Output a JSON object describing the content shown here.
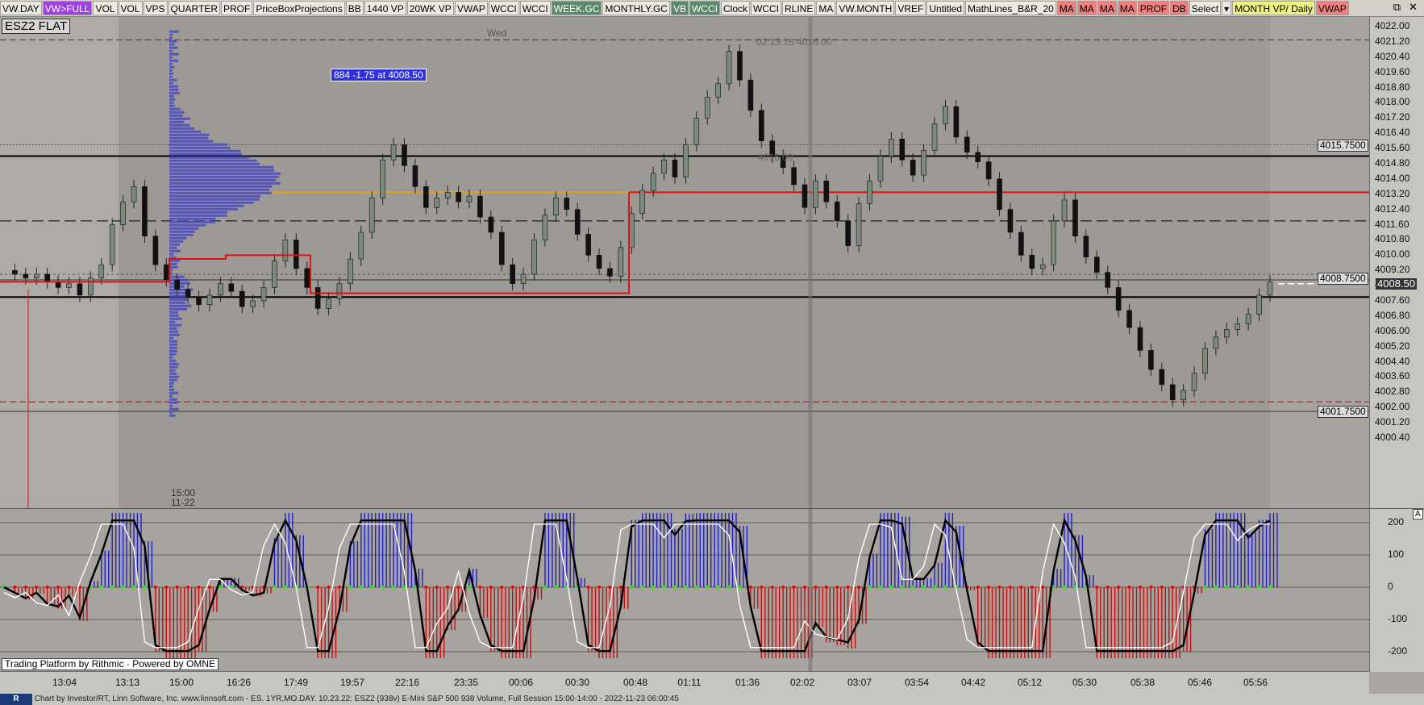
{
  "toolbar": {
    "buttons": [
      {
        "label": "VW.DAY",
        "bg": "#ece9e0"
      },
      {
        "label": "VW>FULL",
        "bg": "#a040e0",
        "color": "#fff"
      },
      {
        "label": "VOL",
        "bg": "#ece9e0"
      },
      {
        "label": "VOL",
        "bg": "#ece9e0"
      },
      {
        "label": "VPS",
        "bg": "#ece9e0"
      },
      {
        "label": "QUARTER",
        "bg": "#ece9e0"
      },
      {
        "label": "PROF",
        "bg": "#ece9e0"
      },
      {
        "label": "PriceBoxProjections",
        "bg": "#ece9e0"
      },
      {
        "label": "BB",
        "bg": "#ece9e0"
      },
      {
        "label": "1440 VP",
        "bg": "#ece9e0"
      },
      {
        "label": "20WK VP",
        "bg": "#ece9e0"
      },
      {
        "label": "VWAP",
        "bg": "#ece9e0"
      },
      {
        "label": "WCCI",
        "bg": "#ece9e0"
      },
      {
        "label": "WCCI",
        "bg": "#ece9e0"
      },
      {
        "label": "WEEK.GC",
        "bg": "#5a8a6a",
        "color": "#fff"
      },
      {
        "label": "MONTHLY.GC",
        "bg": "#ece9e0"
      },
      {
        "label": "VB",
        "bg": "#5a8a6a",
        "color": "#fff"
      },
      {
        "label": "WCCI",
        "bg": "#5a8a6a",
        "color": "#fff"
      },
      {
        "label": "Clock",
        "bg": "#ece9e0"
      },
      {
        "label": "WCCI",
        "bg": "#ece9e0"
      },
      {
        "label": "RLINE",
        "bg": "#ece9e0"
      },
      {
        "label": "MA",
        "bg": "#ece9e0"
      },
      {
        "label": "VW.MONTH",
        "bg": "#ece9e0"
      },
      {
        "label": "VREF",
        "bg": "#ece9e0"
      },
      {
        "label": "Untitled",
        "bg": "#ece9e0"
      },
      {
        "label": "MathLines_B&R_20",
        "bg": "#ece9e0"
      },
      {
        "label": "MA",
        "bg": "#f08080"
      },
      {
        "label": "MA",
        "bg": "#f08080"
      },
      {
        "label": "MA",
        "bg": "#f08080"
      },
      {
        "label": "MA",
        "bg": "#f08080"
      },
      {
        "label": "PROF",
        "bg": "#f08080"
      },
      {
        "label": "DB",
        "bg": "#f08080"
      },
      {
        "label": "Select",
        "bg": "#ece9e0"
      },
      {
        "label": "▾",
        "bg": "#ece9e0"
      },
      {
        "label": "MONTH VP/ Daily",
        "bg": "#f0f080"
      },
      {
        "label": "VWAP",
        "bg": "#f08080"
      }
    ],
    "window_controls": [
      "⧉",
      "✕"
    ]
  },
  "chart": {
    "symbol": "ESZ2 FLAT",
    "day_label": "Wed",
    "info_box": "884  -1.75 at 4008.50",
    "high_label": "02:13:16  4016.00",
    "mid_label": "4016.00",
    "session_start_time": "15:00",
    "session_start_date": "11-22",
    "price_labels": [
      "4022.00",
      "4021.20",
      "4020.40",
      "4019.60",
      "4018.80",
      "4018.00",
      "4017.20",
      "4016.40",
      "4015.60",
      "4014.80",
      "4014.00",
      "4013.20",
      "4012.40",
      "4011.60",
      "4010.80",
      "4010.00",
      "4009.20",
      "4008.40",
      "4007.60",
      "4006.80",
      "4006.00",
      "4005.20",
      "4004.40",
      "4003.60",
      "4002.80",
      "4002.00",
      "4001.20",
      "4000.40"
    ],
    "box_labels": [
      {
        "text": "4015.7500",
        "price": 4015.75
      },
      {
        "text": "4008.7500",
        "price": 4008.75
      },
      {
        "text": "4001.7500",
        "price": 4001.75
      }
    ],
    "last_price": "4008.50",
    "time_labels": [
      "13:04",
      "13:13",
      "15:00",
      "16:26",
      "17:49",
      "19:57",
      "22:16",
      "23:35",
      "00:06",
      "00:30",
      "00:48",
      "01:11",
      "01:36",
      "02:02",
      "03:07",
      "03:54",
      "04:42",
      "05:12",
      "05:30",
      "05:38",
      "05:46",
      "05:56"
    ]
  },
  "oscillator": {
    "labels": [
      "200",
      "100",
      "0",
      "-100",
      "-200"
    ],
    "corner": "A"
  },
  "branding": {
    "rithmic": "Trading Platform by Rithmic",
    "omne": "Powered by OMNE",
    "footer": "Chart by Investor/RT, Linn Software, Inc. www.linnsoft.com - ES. 1YR,MO.DAY.    10.23.22: ESZ2 (938v) E-Mini S&P 500 938 Volume, Full Session 15:00-14:00 - 2022-11-23 06:00:45"
  }
}
